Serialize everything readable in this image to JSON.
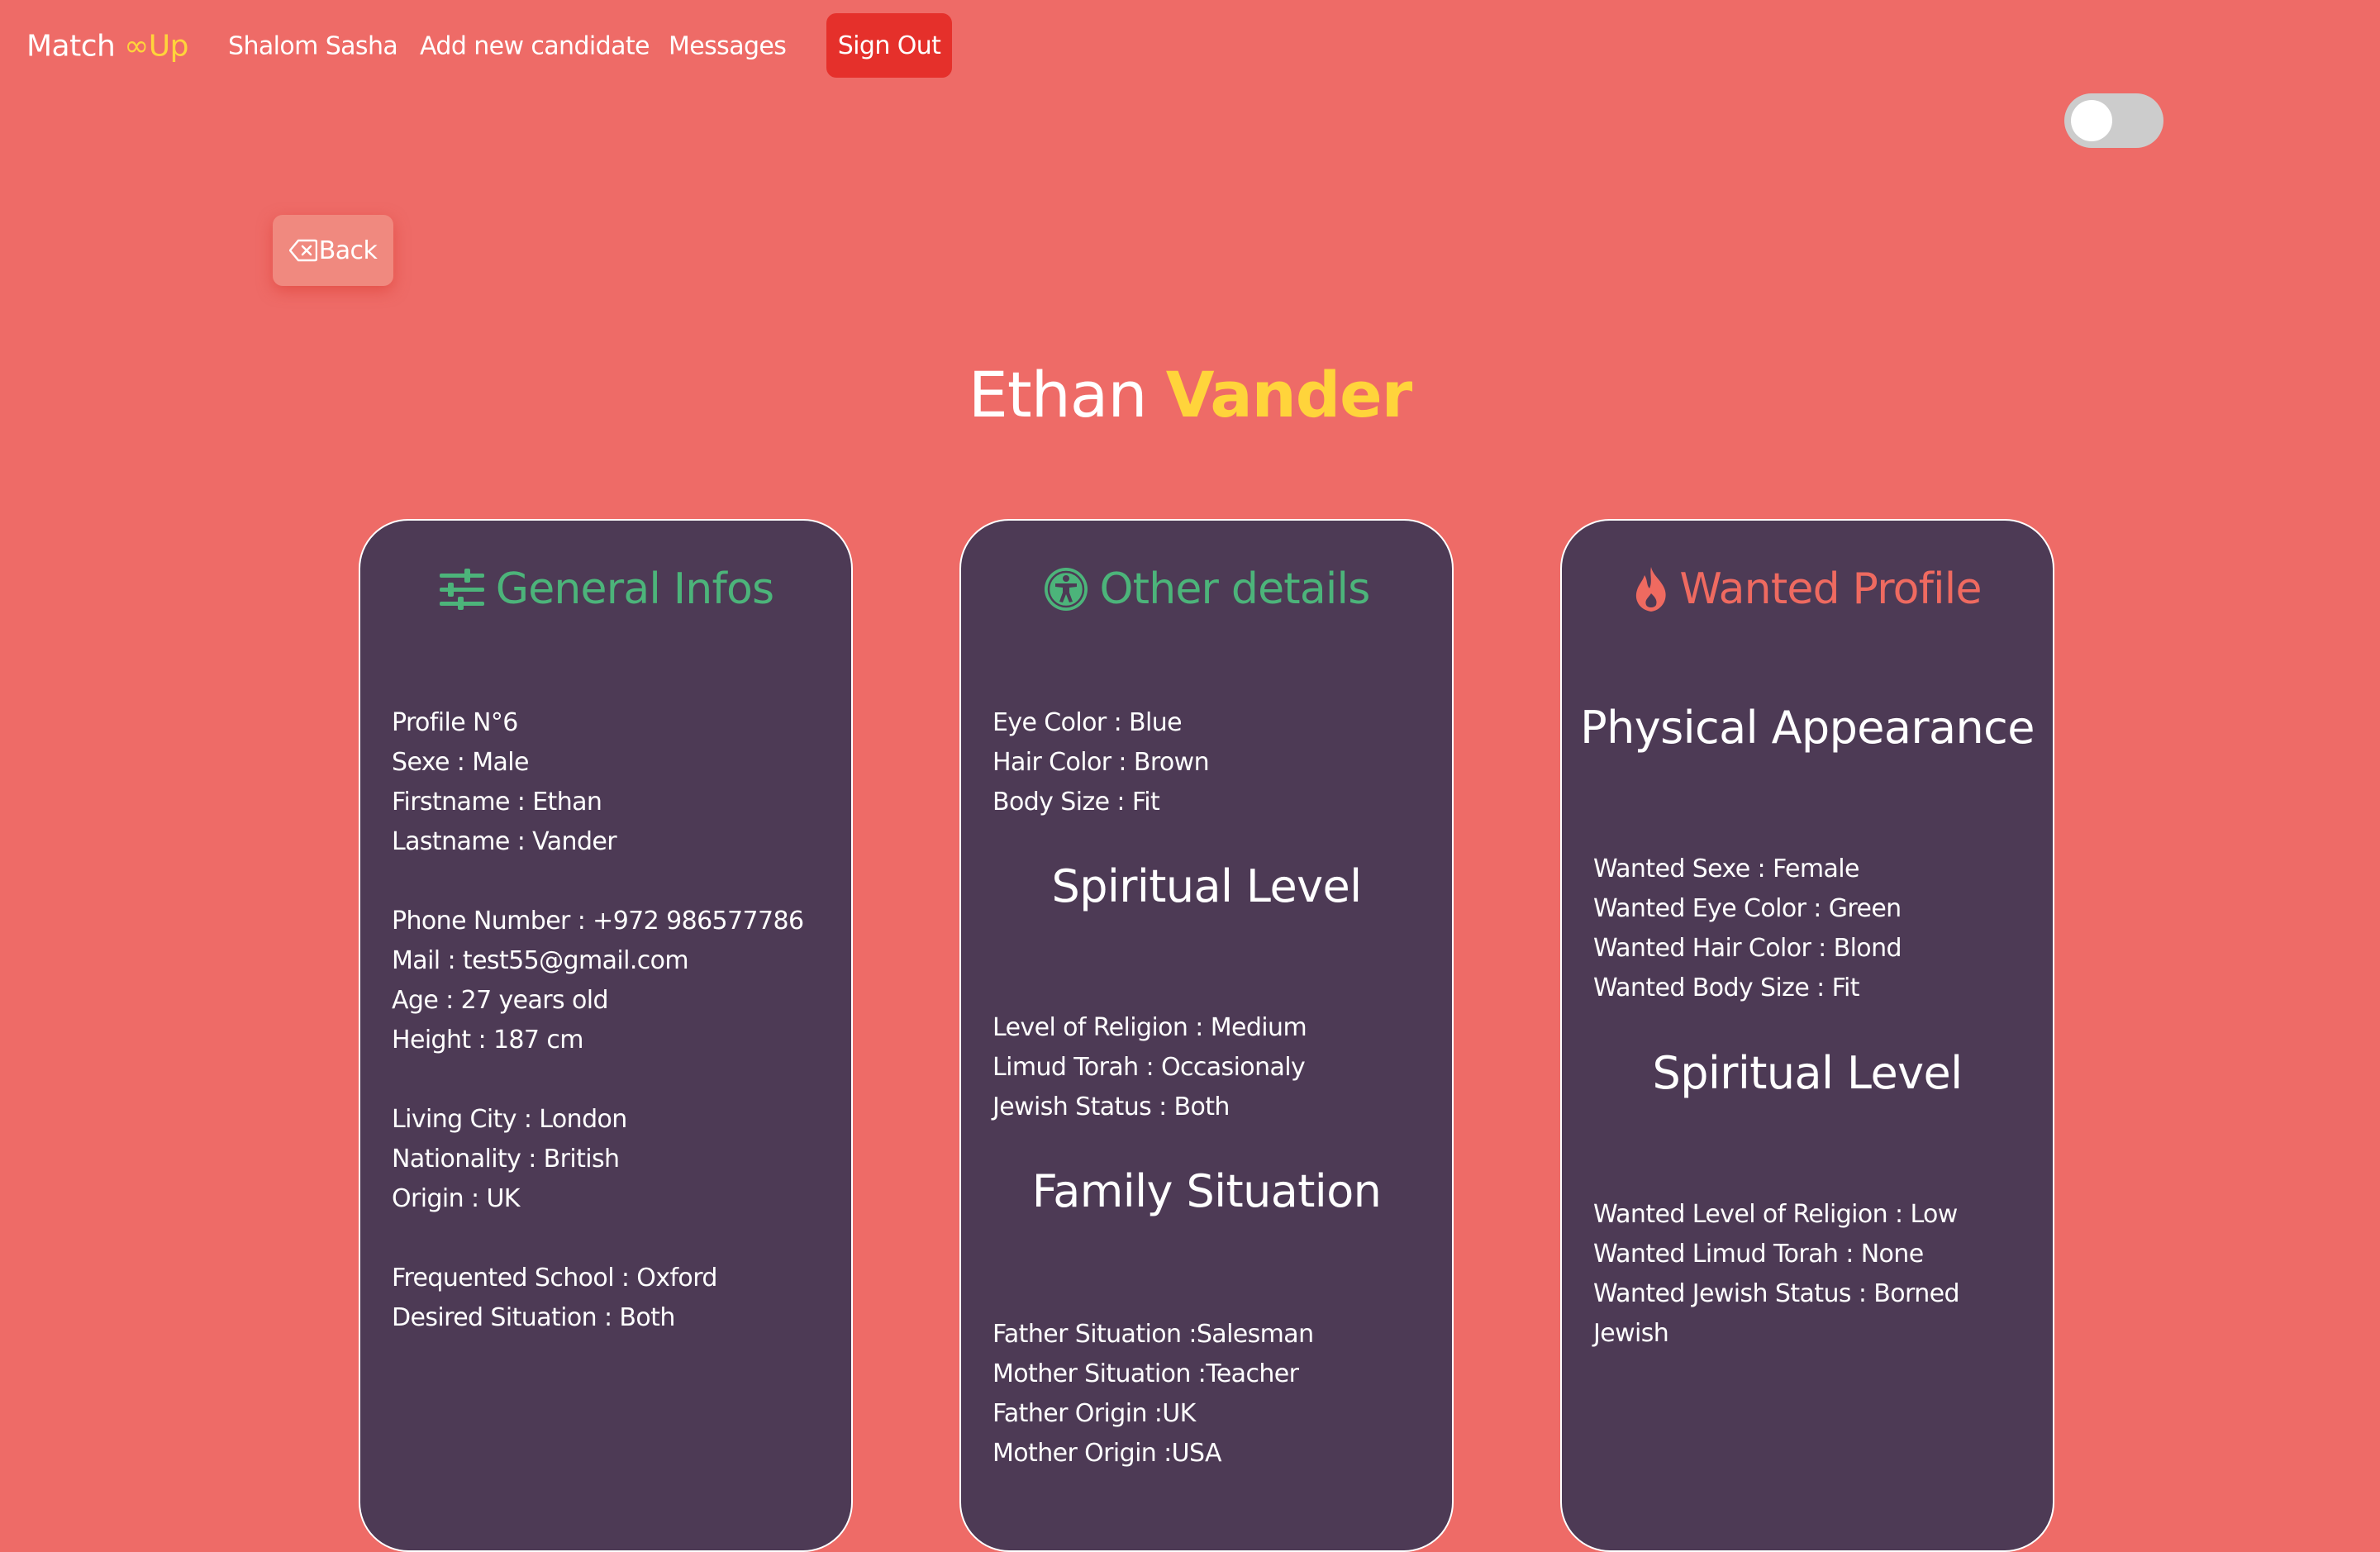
{
  "nav": {
    "brand_main": "Match ",
    "brand_accent": "∞Up",
    "user_link": "Shalom Sasha",
    "add_candidate": "Add new candidate",
    "messages": "Messages",
    "sign_out": "Sign Out"
  },
  "theme_toggle": {
    "state": "off"
  },
  "back_button": {
    "icon": "backspace-icon",
    "label": "Back"
  },
  "candidate": {
    "firstname": "Ethan",
    "lastname": "Vander"
  },
  "general": {
    "title": "General Infos",
    "icon": "sliders-icon",
    "lines": [
      "Profile N°6",
      "Sexe : Male",
      "Firstname : Ethan",
      "Lastname : Vander",
      "Phone Number : +972 986577786",
      "Mail : test55@gmail.com",
      "Age : 27 years old",
      "Height : 187 cm",
      "Living City : London",
      "Nationality : British",
      "Origin : UK",
      "Frequented School : Oxford",
      "Desired Situation : Both"
    ]
  },
  "other": {
    "title": "Other details",
    "icon": "accessibility-icon",
    "appearance": [
      "Eye Color : Blue",
      "Hair Color : Brown",
      "Body Size : Fit"
    ],
    "spiritual_title": "Spiritual Level",
    "spiritual": [
      "Level of Religion : Medium",
      "Limud Torah : Occasionaly",
      "Jewish Status : Both"
    ],
    "family_title": "Family Situation",
    "family": [
      "Father Situation :Salesman",
      "Mother Situation :Teacher",
      "Father Origin :UK",
      "Mother Origin :USA"
    ]
  },
  "wanted": {
    "title": "Wanted Profile",
    "icon": "fire-icon",
    "appearance_title": "Physical Appearance",
    "appearance": [
      "Wanted Sexe : Female",
      "Wanted Eye Color : Green",
      "Wanted Hair Color : Blond",
      "Wanted Body Size : Fit"
    ],
    "spiritual_title": "Spiritual Level",
    "spiritual": [
      "Wanted Level of Religion : Low",
      "Wanted Limud Torah : None",
      "Wanted Jewish Status : Borned",
      "Jewish"
    ]
  },
  "colors": {
    "background": "#ee6b67",
    "card": "#4d3a55",
    "accent_yellow": "#ffd43b",
    "accent_green": "#4cb47a",
    "accent_red": "#ef6a60",
    "sign_out": "#e5302b"
  }
}
